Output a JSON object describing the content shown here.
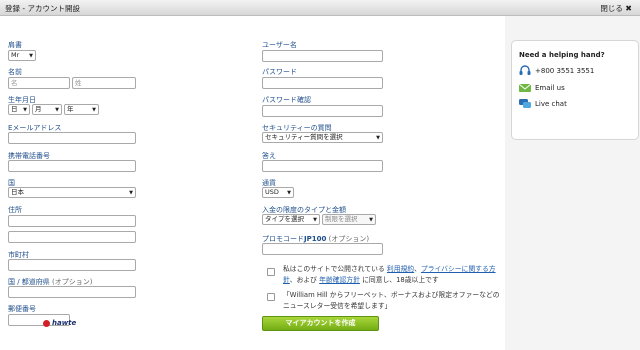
{
  "window": {
    "title": "登録 - アカウント開設",
    "close_label": "閉じる"
  },
  "left": {
    "title_label": "肩書",
    "title_value": "Mr",
    "name_label": "名前",
    "first_name_placeholder": "名",
    "last_name_placeholder": "姓",
    "dob_label": "生年月日",
    "dob_day": "日",
    "dob_month": "月",
    "dob_year": "年",
    "email_label": "Eメールアドレス",
    "mobile_label": "携帯電話番号",
    "country_label": "国",
    "country_value": "日本",
    "address_label": "住所",
    "city_label": "市町村",
    "state_label": "国 / 都道府県",
    "state_optional": "(オプション)",
    "postal_label": "郵便番号",
    "logo_text": "hawte"
  },
  "right": {
    "username_label": "ユーザー名",
    "password_label": "パスワード",
    "password_confirm_label": "パスワード確認",
    "security_q_label": "セキュリティーの質問",
    "security_q_value": "セキュリティー質問を選択",
    "answer_label": "答え",
    "currency_label": "通貨",
    "currency_value": "USD",
    "deposit_limit_label": "入金の限度のタイプと金額",
    "limit_type_value": "タイプを選択",
    "limit_amount_value": "制限を選択",
    "promo_label_prefix": "プロモコード",
    "promo_code": "JP100",
    "promo_optional": "(オプション)",
    "terms1_a": "私はこのサイトで公開されている",
    "terms1_link1": "利用規約",
    "terms1_sep": "、",
    "terms1_link2": "プライバシーに関する方針",
    "terms1_b": "、および",
    "terms1_link3": "年齢確認方針",
    "terms1_c": "に同意し、18歳以上です",
    "terms2": "「William Hill からフリーベット、ボーナスおよび限定オファーなどのニュースレター受信を希望します」",
    "submit_label": "マイアカウントを作成"
  },
  "help": {
    "title": "Need a helping hand?",
    "phone": "+800 3551 3551",
    "email": "Email us",
    "chat": "Live chat"
  }
}
